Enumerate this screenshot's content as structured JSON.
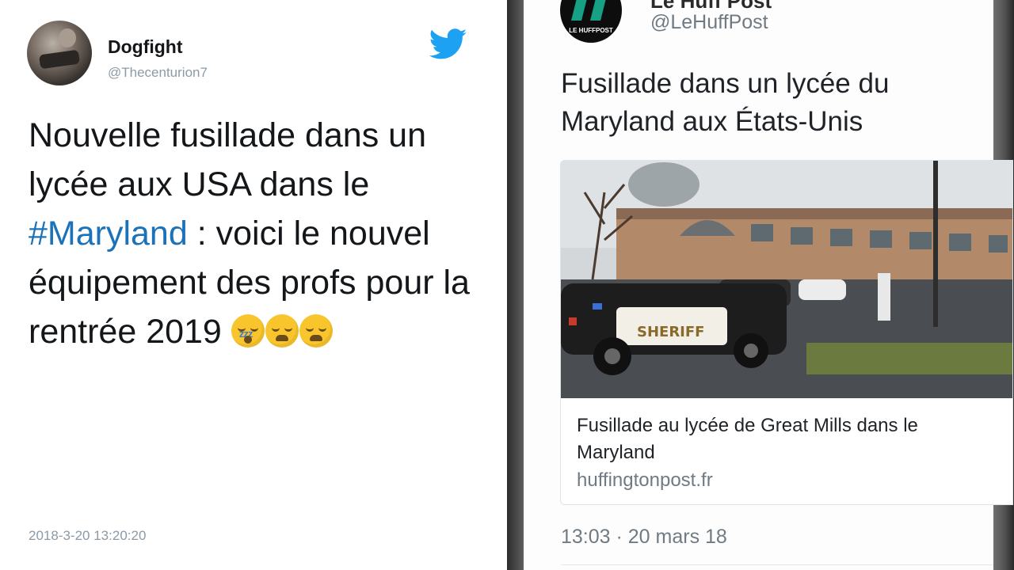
{
  "left_tweet": {
    "author_name": "Dogfight",
    "author_handle": "@Thecenturion7",
    "text_part1": "Nouvelle fusillade dans un lycée aux USA dans le ",
    "hashtag": "#Maryland",
    "text_part2": " : voici le nouvel équipement des profs pour la rentrée 2019",
    "emojis": [
      "sleeping-face",
      "weary-face",
      "weary-face"
    ],
    "timestamp": "2018-3-20 13:20:20",
    "icons": {
      "brand": "twitter-bird-icon",
      "brand_color": "#1da1f2"
    },
    "hashtag_color": "#1b72b8"
  },
  "embedded_tweet": {
    "author_name": "Le Huff Post",
    "author_handle": "@LeHuffPost",
    "logo_text": "LE HUFFPOST",
    "logo_color": "#16a184",
    "text": "Fusillade dans un lycée du Maryland aux États-Unis",
    "card": {
      "title": "Fusillade au lycée de Great Mills dans le Maryland",
      "domain": "huffingtonpost.fr",
      "vehicle_text": "SHERIFF"
    },
    "timestamp": "13:03 · 20 mars 18"
  }
}
